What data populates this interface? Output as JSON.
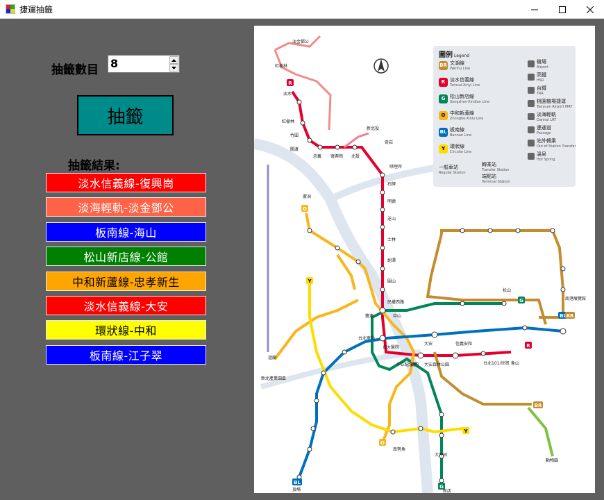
{
  "window": {
    "title": "捷運抽籤"
  },
  "form": {
    "count_label": "抽籤數目",
    "count_value": "8",
    "draw_button": "抽籤",
    "result_label": "抽籤結果:"
  },
  "results": [
    {
      "text": "淡水信義線-復興崗",
      "color": "#ff0000"
    },
    {
      "text": "淡海輕軌-淡金鄧公",
      "color": "#ff6347"
    },
    {
      "text": "板南線-海山",
      "color": "#0000ff"
    },
    {
      "text": "松山新店線-公館",
      "color": "#008000"
    },
    {
      "text": "中和新蘆線-忠孝新生",
      "color": "#ffa500"
    },
    {
      "text": "淡水信義線-大安",
      "color": "#ff0000"
    },
    {
      "text": "環狀線-中和",
      "color": "#ffff00"
    },
    {
      "text": "板南線-江子翠",
      "color": "#0000ff"
    }
  ],
  "map": {
    "legend": {
      "title": "圖例",
      "title_en": "Legend",
      "lines": [
        {
          "code": "BR",
          "name": "文湖線",
          "en": "Wenhu Line",
          "color": "#c48c31"
        },
        {
          "code": "R",
          "name": "淡水信義線",
          "en": "Tamsui-Xinyi Line",
          "color": "#e3002c"
        },
        {
          "code": "G",
          "name": "松山新店線",
          "en": "Songshan-Xindian Line",
          "color": "#008659"
        },
        {
          "code": "O",
          "name": "中和新蘆線",
          "en": "Zhonghe-Xinlu Line",
          "color": "#f8b61c"
        },
        {
          "code": "BL",
          "name": "板南線",
          "en": "Bannan Line",
          "color": "#0070bd"
        },
        {
          "code": "Y",
          "name": "環狀線",
          "en": "Circular Line",
          "color": "#ffdb00"
        }
      ],
      "facilities": [
        {
          "name": "機場",
          "en": "Airport",
          "icon": "airport-icon"
        },
        {
          "name": "高鐵",
          "en": "HSR",
          "icon": "hsr-icon"
        },
        {
          "name": "台鐵",
          "en": "TRA",
          "icon": "tra-icon"
        },
        {
          "name": "桃園機場捷運",
          "en": "Taoyuan Airport MRT",
          "icon": "airport-mrt-icon"
        },
        {
          "name": "淡海輕軌",
          "en": "Danhai LRT",
          "icon": "lrt-icon"
        },
        {
          "name": "連通道",
          "en": "Passage",
          "icon": "passage-icon"
        },
        {
          "name": "站外轉乘",
          "en": "Out of Station Transfer",
          "icon": "transfer-out-icon"
        },
        {
          "name": "溫泉",
          "en": "Hot Spring",
          "icon": "hot-spring-icon"
        }
      ],
      "station_types": [
        {
          "name": "一般車站",
          "en": "Regular Station"
        },
        {
          "name": "轉乘站",
          "en": "Transfer Station"
        },
        {
          "name": "端點站",
          "en": "Terminal Station"
        }
      ]
    },
    "stations": [
      {
        "name": "淡水",
        "line": "R"
      },
      {
        "name": "紅樹林",
        "line": "R"
      },
      {
        "name": "竹圍",
        "line": "R"
      },
      {
        "name": "關渡",
        "line": "R"
      },
      {
        "name": "忠義",
        "line": "R"
      },
      {
        "name": "復興崗",
        "line": "R"
      },
      {
        "name": "北投",
        "line": "R"
      },
      {
        "name": "奇岩",
        "line": "R"
      },
      {
        "name": "唭哩岸",
        "line": "R"
      },
      {
        "name": "石牌",
        "line": "R"
      },
      {
        "name": "明德",
        "line": "R"
      },
      {
        "name": "芝山",
        "line": "R"
      },
      {
        "name": "士林",
        "line": "R"
      },
      {
        "name": "劍潭",
        "line": "R"
      },
      {
        "name": "圓山",
        "line": "R"
      },
      {
        "name": "民權西路",
        "line": "R"
      },
      {
        "name": "雙連",
        "line": "R"
      },
      {
        "name": "中山",
        "line": "R"
      },
      {
        "name": "台北車站",
        "line": "R"
      },
      {
        "name": "台大醫院",
        "line": "R"
      },
      {
        "name": "中正紀念堂",
        "line": "R"
      },
      {
        "name": "東門",
        "line": "R"
      },
      {
        "name": "大安森林公園",
        "line": "R"
      },
      {
        "name": "大安",
        "line": "R"
      },
      {
        "name": "信義安和",
        "line": "R"
      },
      {
        "name": "台北101/世貿",
        "line": "R"
      },
      {
        "name": "象山",
        "line": "R"
      },
      {
        "name": "新北投",
        "line": "R"
      },
      {
        "name": "南港展覽館",
        "line": "BR"
      },
      {
        "name": "動物園",
        "line": "BR"
      },
      {
        "name": "南勢角",
        "line": "O"
      },
      {
        "name": "迴龍",
        "line": "O"
      },
      {
        "name": "蘆洲",
        "line": "O"
      },
      {
        "name": "頂埔",
        "line": "BL"
      },
      {
        "name": "新店",
        "line": "G"
      },
      {
        "name": "松山",
        "line": "G"
      },
      {
        "name": "大坪林",
        "line": "Y"
      },
      {
        "name": "新北產業園區",
        "line": "Y"
      },
      {
        "name": "淡金鄧公",
        "line": "LRT"
      },
      {
        "name": "紅樹林",
        "line": "LRT"
      }
    ]
  }
}
